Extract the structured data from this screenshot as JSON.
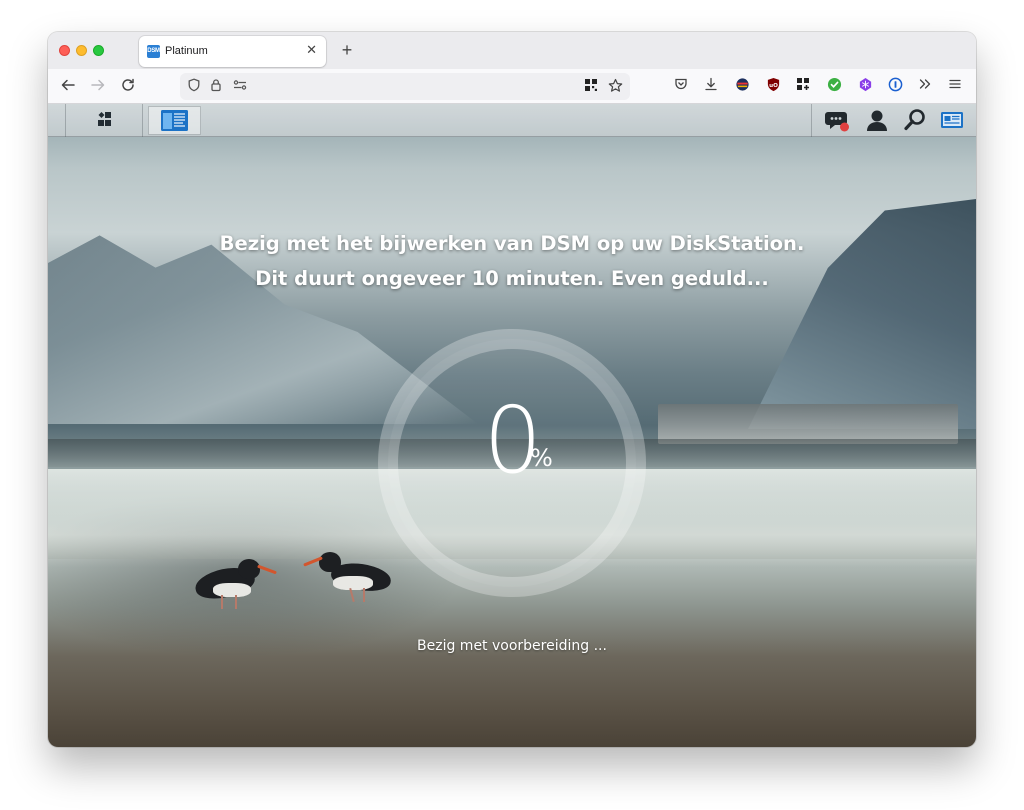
{
  "browser": {
    "tab": {
      "favicon_text": "DSM",
      "title": "Platinum",
      "close": "✕"
    },
    "new_tab": "+"
  },
  "dsm": {
    "headline_line1": "Bezig met het bijwerken van DSM op uw DiskStation.",
    "headline_line2": "Dit duurt ongeveer 10 minuten. Even geduld...",
    "progress": {
      "value": "0",
      "unit": "%"
    },
    "status": "Bezig met voorbereiding ...",
    "notification_color": "#e04040"
  },
  "icons": {
    "nav": [
      "back-arrow-icon",
      "forward-arrow-icon",
      "reload-icon"
    ],
    "url": [
      "shield-icon",
      "lock-icon",
      "site-permissions-icon",
      "qr-code-icon",
      "star-icon"
    ],
    "toolbar": [
      "pocket-icon",
      "download-icon",
      "extension-globe-icon",
      "ublock-icon",
      "extension-grid-icon",
      "extension-check-icon",
      "extension-gem-icon",
      "password-manager-icon",
      "overflow-icon",
      "menu-icon"
    ],
    "dsm": [
      "main-menu-icon",
      "control-panel-icon",
      "notifications-icon",
      "user-icon",
      "search-icon",
      "widgets-icon"
    ]
  }
}
